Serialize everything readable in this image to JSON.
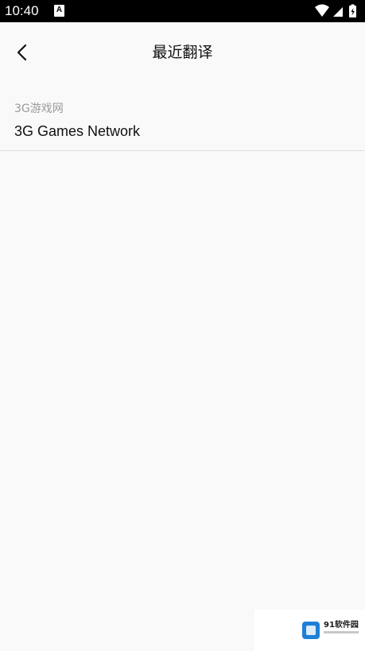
{
  "status_bar": {
    "time": "10:40",
    "app_icon_letter": "A",
    "icons": [
      "wifi-icon",
      "signal-icon",
      "battery-icon"
    ],
    "colors": {
      "background": "#000000",
      "foreground": "#ffffff"
    }
  },
  "header": {
    "back_icon": "chevron-left-icon",
    "title": "最近翻译"
  },
  "recent_translations": [
    {
      "source": "3G游戏网",
      "translation": "3G Games Network"
    }
  ],
  "watermark": {
    "text": "91软件园"
  },
  "colors": {
    "background": "#f9f9f9",
    "title_text": "#111111",
    "secondary_text": "#9a9a9a",
    "divider": "#e2e2e2",
    "watermark_accent": "#1e7fd6"
  }
}
